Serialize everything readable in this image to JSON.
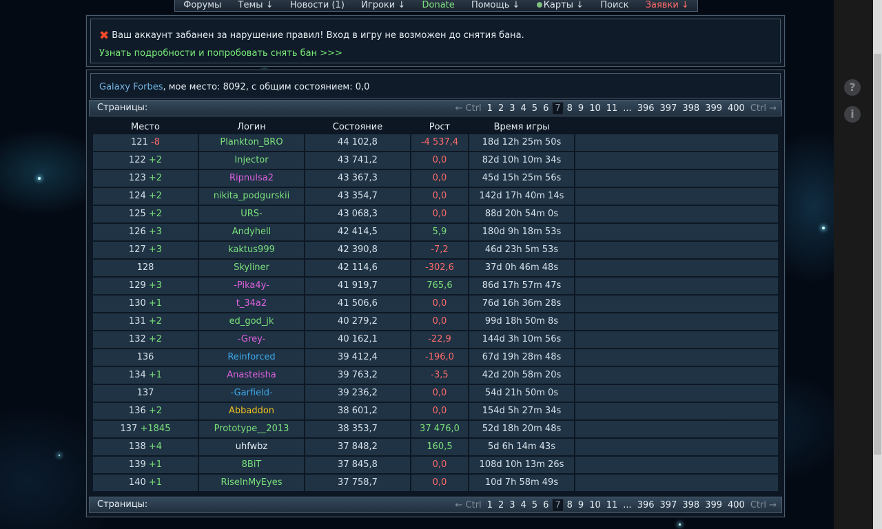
{
  "nav": {
    "items": [
      {
        "id": "forums",
        "label": "Форумы"
      },
      {
        "id": "topics",
        "label": "Темы ↓"
      },
      {
        "id": "news",
        "label": "Новости (1)"
      },
      {
        "id": "players",
        "label": "Игроки ↓"
      },
      {
        "id": "donate",
        "label": "Donate"
      },
      {
        "id": "help",
        "label": "Помощь ↓"
      },
      {
        "id": "maps",
        "label": "Карты ↓"
      },
      {
        "id": "search",
        "label": "Поиск"
      },
      {
        "id": "requests",
        "label": "Заявки ↓"
      }
    ]
  },
  "ban": {
    "message": "Ваш аккаунт забанен за нарушение правил! Вход в игру не возможен до снятия бана.",
    "link": "Узнать подробности и попробовать снять бан >>>"
  },
  "forbes": {
    "title": "Galaxy Forbes",
    "text": ", мое место: 8092, с общим состоянием: 0,0"
  },
  "pager": {
    "label": "Страницы:",
    "prev": "← Ctrl",
    "next": "Ctrl →",
    "pages": [
      "1",
      "2",
      "3",
      "4",
      "5",
      "6",
      "7",
      "8",
      "9",
      "10",
      "11",
      "...",
      "396",
      "397",
      "398",
      "399",
      "400"
    ],
    "current": "7"
  },
  "table": {
    "headers": {
      "place": "Место",
      "login": "Логин",
      "wealth": "Состояние",
      "growth": "Рост",
      "time": "Время игры"
    },
    "rows": [
      {
        "place": "121",
        "delta": "-8",
        "delta_type": "down",
        "login": "Plankton_BRO",
        "login_color": "#7be07b",
        "wealth": "44 102,8",
        "growth": "-4 537,4",
        "growth_type": "neg",
        "time": "18d 12h 25m 50s"
      },
      {
        "place": "122",
        "delta": "+2",
        "delta_type": "up",
        "login": "Injector",
        "login_color": "#7be07b",
        "wealth": "43 741,2",
        "growth": "0,0",
        "growth_type": "neg",
        "time": "82d 10h 10m 34s"
      },
      {
        "place": "123",
        "delta": "+2",
        "delta_type": "up",
        "login": "Ripnulsa2",
        "login_color": "#e060e0",
        "wealth": "43 367,3",
        "growth": "0,0",
        "growth_type": "neg",
        "time": "45d 15h 25m 56s"
      },
      {
        "place": "124",
        "delta": "+2",
        "delta_type": "up",
        "login": "nikita_podgurskii",
        "login_color": "#7be07b",
        "wealth": "43 354,7",
        "growth": "0,0",
        "growth_type": "neg",
        "time": "142d 17h 40m 14s"
      },
      {
        "place": "125",
        "delta": "+2",
        "delta_type": "up",
        "login": "URS-",
        "login_color": "#7be07b",
        "wealth": "43 068,3",
        "growth": "0,0",
        "growth_type": "neg",
        "time": "88d 20h 54m 0s"
      },
      {
        "place": "126",
        "delta": "+3",
        "delta_type": "up",
        "login": "Andyhell",
        "login_color": "#7be07b",
        "wealth": "42 414,5",
        "growth": "5,9",
        "growth_type": "pos",
        "time": "180d 9h 18m 53s"
      },
      {
        "place": "127",
        "delta": "+3",
        "delta_type": "up",
        "login": "kaktus999",
        "login_color": "#7be07b",
        "wealth": "42 390,8",
        "growth": "-7,2",
        "growth_type": "neg",
        "time": "46d 23h 5m 53s"
      },
      {
        "place": "128",
        "delta": "",
        "delta_type": "none",
        "login": "Skyliner",
        "login_color": "#7be07b",
        "wealth": "42 114,6",
        "growth": "-302,6",
        "growth_type": "neg",
        "time": "37d 0h 46m 48s"
      },
      {
        "place": "129",
        "delta": "+3",
        "delta_type": "up",
        "login": "-Pika4y-",
        "login_color": "#e060e0",
        "wealth": "41 919,7",
        "growth": "765,6",
        "growth_type": "pos",
        "time": "86d 17h 57m 47s"
      },
      {
        "place": "130",
        "delta": "+1",
        "delta_type": "up",
        "login": "t_34a2",
        "login_color": "#e060e0",
        "wealth": "41 506,6",
        "growth": "0,0",
        "growth_type": "neg",
        "time": "76d 16h 36m 28s"
      },
      {
        "place": "131",
        "delta": "+2",
        "delta_type": "up",
        "login": "ed_god_jk",
        "login_color": "#7be07b",
        "wealth": "40 279,2",
        "growth": "0,0",
        "growth_type": "neg",
        "time": "99d 18h 50m 8s"
      },
      {
        "place": "132",
        "delta": "+2",
        "delta_type": "up",
        "login": "-Grey-",
        "login_color": "#e060e0",
        "wealth": "40 162,1",
        "growth": "-22,9",
        "growth_type": "neg",
        "time": "144d 3h 10m 56s"
      },
      {
        "place": "136",
        "delta": "",
        "delta_type": "none",
        "login": "Reinforced",
        "login_color": "#3fa8e8",
        "wealth": "39 412,4",
        "growth": "-196,0",
        "growth_type": "neg",
        "time": "67d 19h 28m 48s"
      },
      {
        "place": "134",
        "delta": "+1",
        "delta_type": "up",
        "login": "Anasteisha",
        "login_color": "#e060e0",
        "wealth": "39 763,2",
        "growth": "-3,5",
        "growth_type": "neg",
        "time": "42d 20h 58m 20s"
      },
      {
        "place": "137",
        "delta": "",
        "delta_type": "none",
        "login": "-Garfield-",
        "login_color": "#3fa8e8",
        "wealth": "39 236,2",
        "growth": "0,0",
        "growth_type": "neg",
        "time": "54d 21h 50m 0s"
      },
      {
        "place": "136",
        "delta": "+2",
        "delta_type": "up",
        "login": "Abbaddon",
        "login_color": "#f0c020",
        "wealth": "38 601,2",
        "growth": "0,0",
        "growth_type": "neg",
        "time": "154d 5h 27m 34s"
      },
      {
        "place": "137",
        "delta": "+1845",
        "delta_type": "up",
        "login": "Prototype__2013",
        "login_color": "#7be07b",
        "wealth": "38 353,7",
        "growth": "37 476,0",
        "growth_type": "pos",
        "time": "52d 18h 20m 48s"
      },
      {
        "place": "138",
        "delta": "+4",
        "delta_type": "up",
        "login": "uhfwbz",
        "login_color": "#e6edf3",
        "wealth": "37 848,2",
        "growth": "160,5",
        "growth_type": "pos",
        "time": "5d 6h 14m 43s"
      },
      {
        "place": "139",
        "delta": "+1",
        "delta_type": "up",
        "login": "8BiT",
        "login_color": "#7be07b",
        "wealth": "37 845,8",
        "growth": "0,0",
        "growth_type": "neg",
        "time": "108d 10h 13m 26s"
      },
      {
        "place": "140",
        "delta": "+1",
        "delta_type": "up",
        "login": "RiseInMyEyes",
        "login_color": "#7be07b",
        "wealth": "37 758,7",
        "growth": "0,0",
        "growth_type": "neg",
        "time": "10d 7h 58m 49s"
      }
    ]
  },
  "side_icons": [
    {
      "name": "help-icon",
      "glyph": "?"
    },
    {
      "name": "info-icon",
      "glyph": "i"
    }
  ]
}
